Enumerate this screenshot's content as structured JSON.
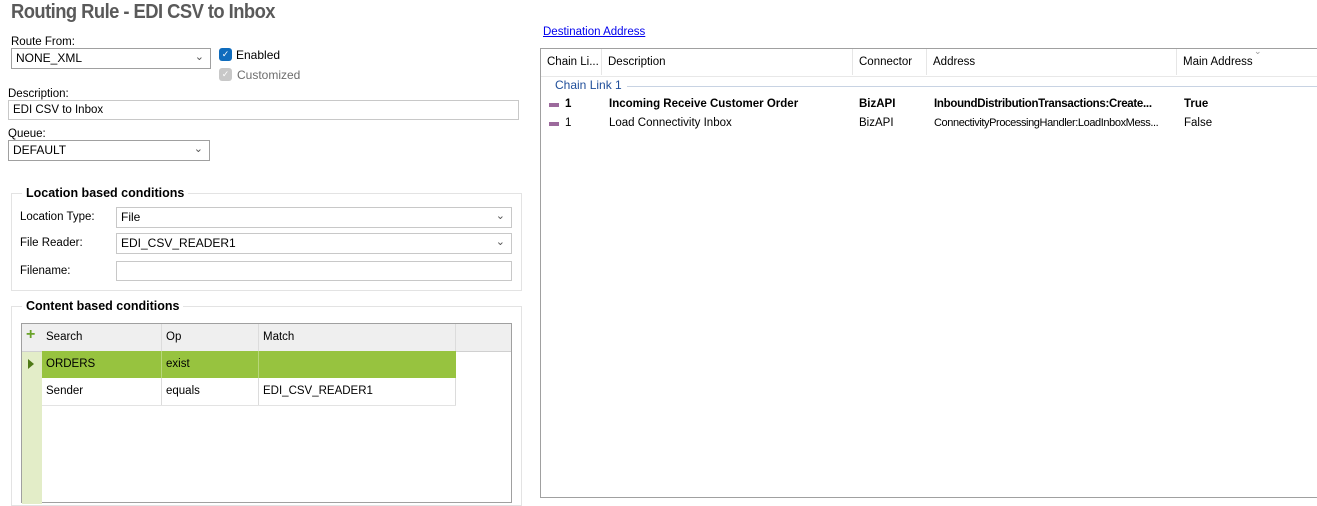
{
  "title": "Routing Rule - EDI CSV to Inbox",
  "route_from": {
    "label": "Route From:",
    "value": "NONE_XML"
  },
  "enabled": {
    "label": "Enabled",
    "checked": true
  },
  "customized": {
    "label": "Customized",
    "checked": true
  },
  "description": {
    "label": "Description:",
    "value": "EDI CSV to Inbox"
  },
  "queue": {
    "label": "Queue:",
    "value": "DEFAULT"
  },
  "location": {
    "title": "Location based conditions",
    "location_type_label": "Location Type:",
    "location_type": "File",
    "file_reader_label": "File Reader:",
    "file_reader": "EDI_CSV_READER1",
    "filename_label": "Filename:",
    "filename": ""
  },
  "content": {
    "title": "Content based conditions",
    "columns": [
      "Search",
      "Op",
      "Match"
    ],
    "rows": [
      [
        "ORDERS",
        "exist",
        ""
      ],
      [
        "Sender",
        "equals",
        "EDI_CSV_READER1"
      ]
    ]
  },
  "destination": {
    "link": "Destination Address",
    "columns": [
      "Chain Li...",
      "Description",
      "Connector",
      "Address",
      "Main Address"
    ],
    "group": "Chain Link 1",
    "rows": [
      [
        "1",
        "Incoming Receive Customer Order",
        "BizAPI",
        "InboundDistributionTransactions:Create...",
        "True"
      ],
      [
        "1",
        "Load Connectivity Inbox",
        "BizAPI",
        "ConnectivityProcessingHandler:LoadInboxMess...",
        "False"
      ]
    ]
  },
  "colors": {
    "selected_row": "#97c33f",
    "checkbox": "#0f6cbd",
    "link": "#0000ee"
  }
}
